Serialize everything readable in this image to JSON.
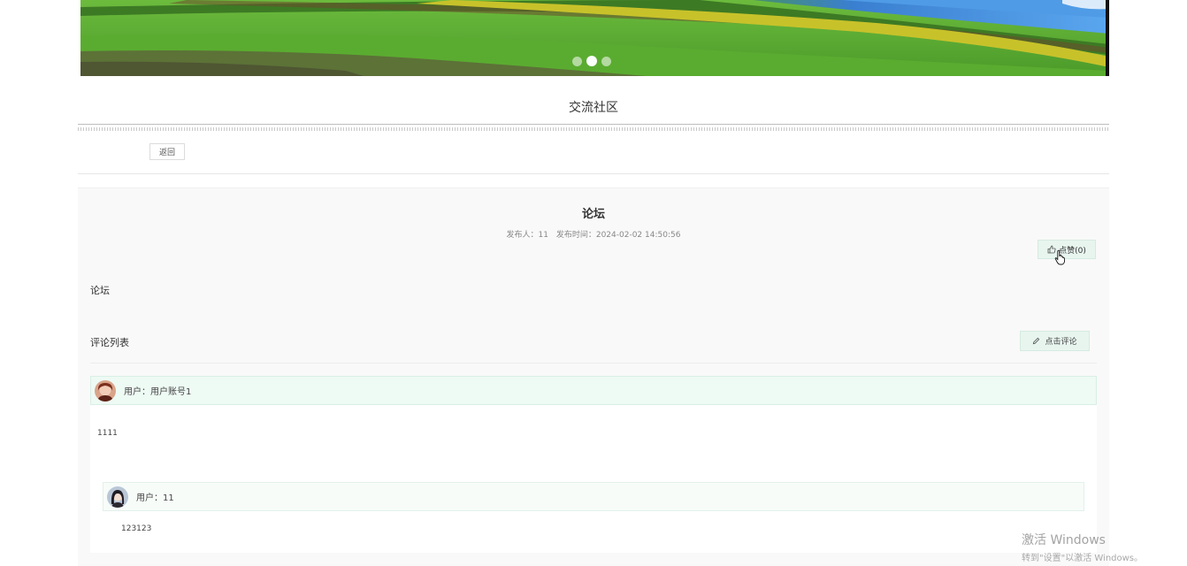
{
  "banner": {
    "dots_total": 3,
    "active_dot": 2
  },
  "section": {
    "title": "交流社区"
  },
  "toolbar": {
    "back_label": "返回"
  },
  "post": {
    "title": "论坛",
    "author_label": "发布人：11",
    "time_label": "发布时间：2024-02-02 14:50:56",
    "like_label": "点赞(0)",
    "body": "论坛"
  },
  "comments": {
    "label": "评论列表",
    "button_label": "点击评论",
    "items": [
      {
        "user": "用户：用户账号1",
        "text": "1111"
      }
    ],
    "reply": {
      "user": "用户：11",
      "text": "123123"
    }
  },
  "watermark": {
    "line1": "激活 Windows",
    "line2": "转到\"设置\"以激活 Windows。"
  },
  "colors": {
    "accent_bg": "#e8f5ef",
    "comment_head_bg": "#eefaf4",
    "panel_bg": "#f9f9f9"
  }
}
